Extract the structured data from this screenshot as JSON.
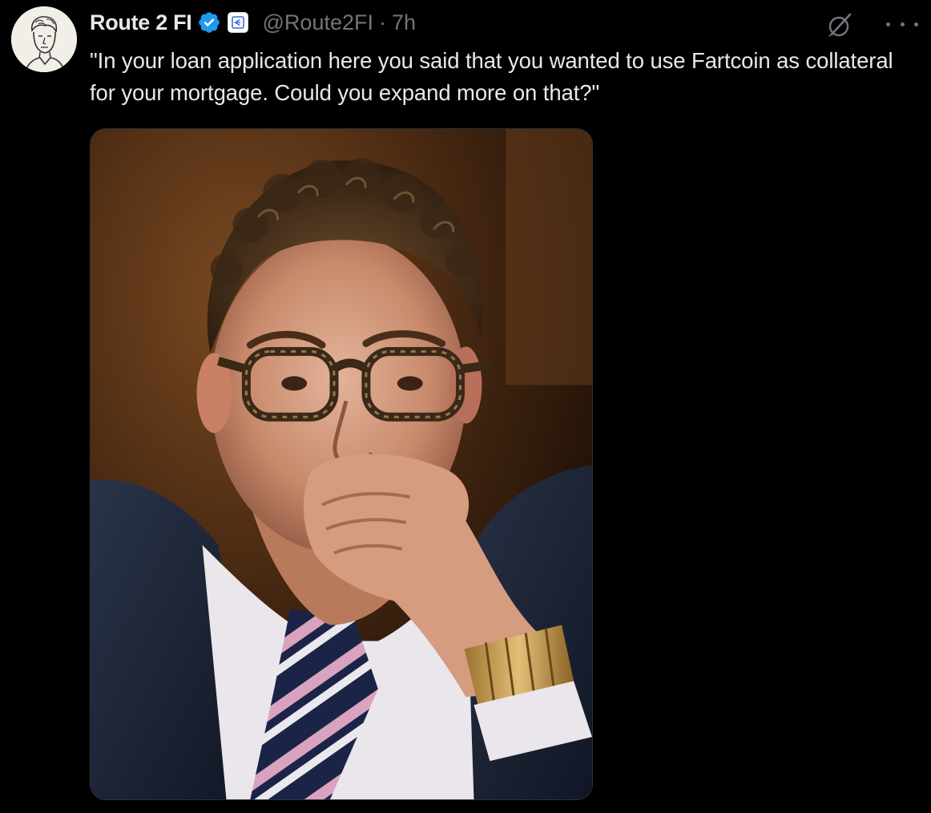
{
  "tweet": {
    "author": {
      "display_name": "Route 2 FI",
      "handle": "@Route2FI",
      "verified": true,
      "verified_color": "#1d9bf0"
    },
    "separator": "·",
    "timestamp": "7h",
    "text": "\"In your loan application here you said that you wanted to use Fartcoin as collateral for your mortgage. Could you expand more on that?\"",
    "icons": {
      "avatar": "avatar-icon",
      "verified": "verified-badge-icon",
      "affiliate": "affiliate-badge-icon",
      "grok": "grok-icon",
      "more": "more-icon"
    },
    "media": {
      "type": "photo"
    }
  },
  "colors": {
    "background": "#000000",
    "primary_text": "#e7e9ea",
    "secondary_text": "#71767b",
    "accent": "#1d9bf0"
  }
}
